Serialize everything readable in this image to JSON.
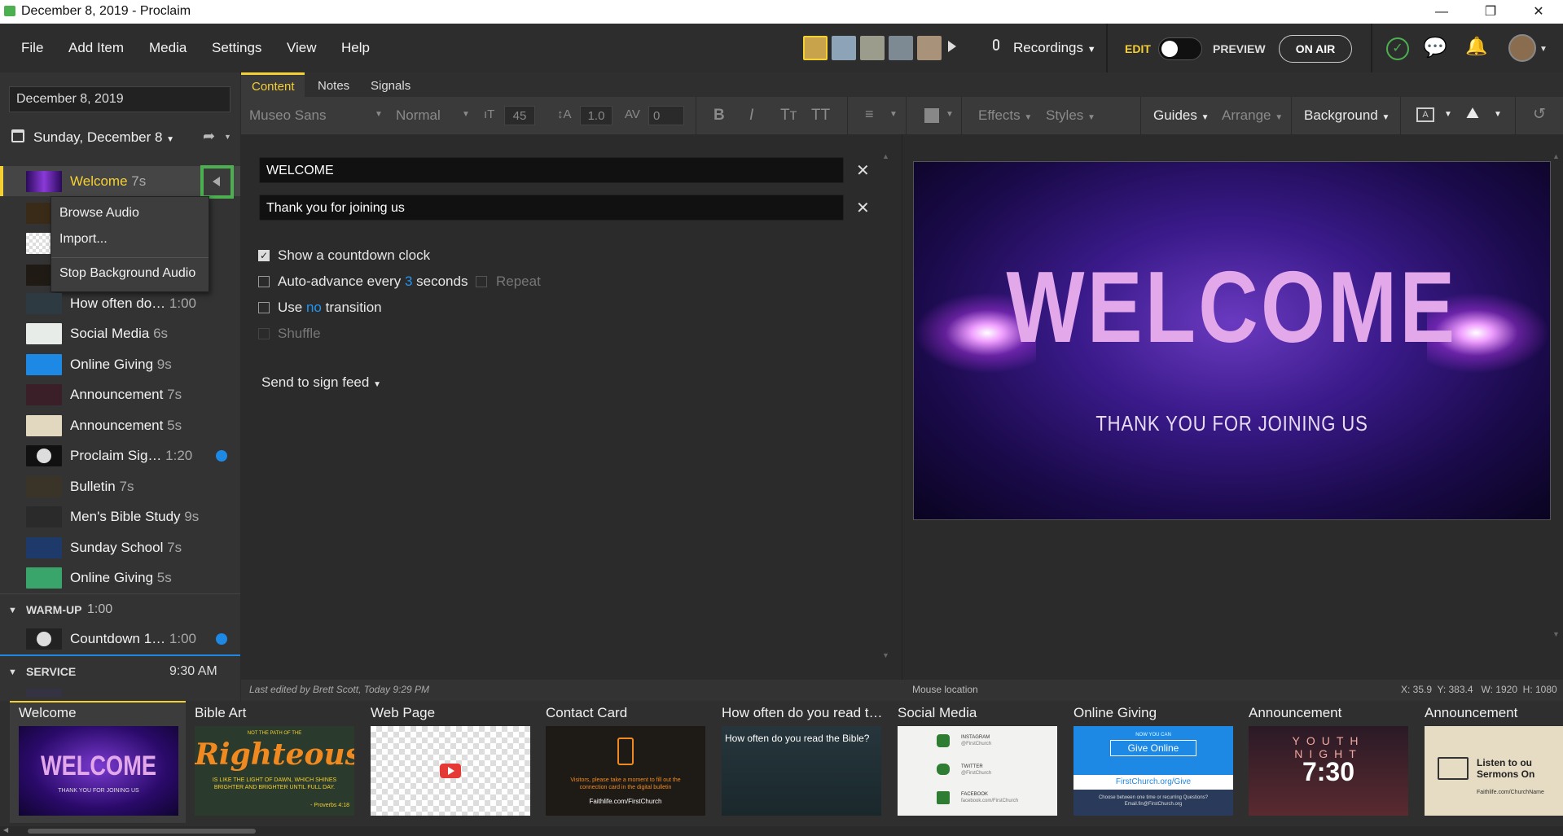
{
  "window": {
    "title": "December 8, 2019 - Proclaim",
    "min": "—",
    "restore": "❐",
    "close": "✕"
  },
  "menu": {
    "file": "File",
    "add_item": "Add Item",
    "media": "Media",
    "settings": "Settings",
    "view": "View",
    "help": "Help",
    "recordings": "Recordings",
    "edit": "EDIT",
    "preview": "PREVIEW",
    "on_air": "ON AIR"
  },
  "left": {
    "date_value": "December 8, 2019",
    "service_date": "Sunday, December 8",
    "items": [
      {
        "label": "Welcome",
        "dur": "7s"
      },
      {
        "label": "How often do…",
        "dur": "1:00"
      },
      {
        "label": "Social Media",
        "dur": "6s"
      },
      {
        "label": "Online Giving",
        "dur": "9s"
      },
      {
        "label": "Announcement",
        "dur": "7s"
      },
      {
        "label": "Announcement",
        "dur": "5s"
      },
      {
        "label": "Proclaim Sig…",
        "dur": "1:20"
      },
      {
        "label": "Bulletin",
        "dur": "7s"
      },
      {
        "label": "Men's Bible Study",
        "dur": "9s"
      },
      {
        "label": "Sunday School",
        "dur": "7s"
      },
      {
        "label": "Online Giving",
        "dur": "5s"
      }
    ],
    "context_menu": {
      "browse": "Browse Audio",
      "import": "Import...",
      "stop": "Stop Background Audio"
    },
    "warmup": {
      "label": "WARM-UP",
      "dur": "1:00",
      "item_label": "Countdown 1…",
      "item_dur": "1:00"
    },
    "service": {
      "label": "SERVICE",
      "time": "9:30 AM"
    }
  },
  "tabs": {
    "content": "Content",
    "notes": "Notes",
    "signals": "Signals"
  },
  "toolbar": {
    "font": "Museo Sans",
    "weight": "Normal",
    "size": "45",
    "line": "1.0",
    "spacing": "0",
    "bold": "B",
    "italic": "I",
    "tt1": "Tт",
    "tt2": "TT",
    "effects": "Effects",
    "styles": "Styles",
    "guides": "Guides",
    "arrange": "Arrange",
    "background": "Background"
  },
  "editor": {
    "line1": "WELCOME",
    "line2": "Thank you for joining us",
    "countdown": "Show a countdown clock",
    "auto_pre": "Auto-advance every",
    "auto_num": "3",
    "auto_post": "seconds",
    "repeat": "Repeat",
    "use_pre": "Use",
    "use_val": "no",
    "use_post": "transition",
    "shuffle": "Shuffle",
    "sign_feed": "Send to sign feed",
    "last_edited": "Last edited by Brett Scott, Today 9:29 PM"
  },
  "preview": {
    "title": "WELCOME",
    "subtitle": "THANK YOU FOR JOINING US",
    "mouse": "Mouse location",
    "coords": "X: 35.9  Y: 383.4   W: 1920  H: 1080"
  },
  "film": [
    {
      "title": "Welcome",
      "thumb_main": "WELCOME",
      "thumb_sub": "THANK YOU FOR JOINING US"
    },
    {
      "title": "Bible Art",
      "thumb_top": "NOT THE PATH OF THE",
      "thumb_main": "Righteous",
      "thumb_sub": "IS LIKE THE LIGHT OF DAWN, WHICH SHINES BRIGHTER AND BRIGHTER UNTIL FULL DAY.",
      "thumb_ref": "- Proverbs 4:18"
    },
    {
      "title": "Web Page"
    },
    {
      "title": "Contact Card",
      "thumb_text": "Visitors, please take a moment to fill out the connection card in the digital bulletin",
      "thumb_url": "Faithlife.com/FirstChurch"
    },
    {
      "title": "How often do you read t…",
      "thumb_text": "How often do you read the Bible?"
    },
    {
      "title": "Social Media",
      "ig": "INSTAGRAM",
      "ig_h": "@FirstChurch",
      "tw": "TWITTER",
      "tw_h": "@FirstChurch",
      "fb": "FACEBOOK",
      "fb_h": "facebook.com/FirstChurch"
    },
    {
      "title": "Online Giving",
      "now": "NOW YOU CAN",
      "give": "Give Online",
      "url": "FirstChurch.org/Give",
      "small": "Choose between one time or recurring Questions? Email.fin@FirstChurch.org"
    },
    {
      "title": "Announcement",
      "youth": "YOUTH",
      "night": "NIGHT",
      "time": "7:30"
    },
    {
      "title": "Announcement",
      "listen": "Listen to ou Sermons On",
      "url": "Faithlife.com/ChurchName"
    }
  ],
  "colors": {
    "accent": "#f5d033",
    "highlight": "#4caf50",
    "blue": "#1e88e5"
  }
}
